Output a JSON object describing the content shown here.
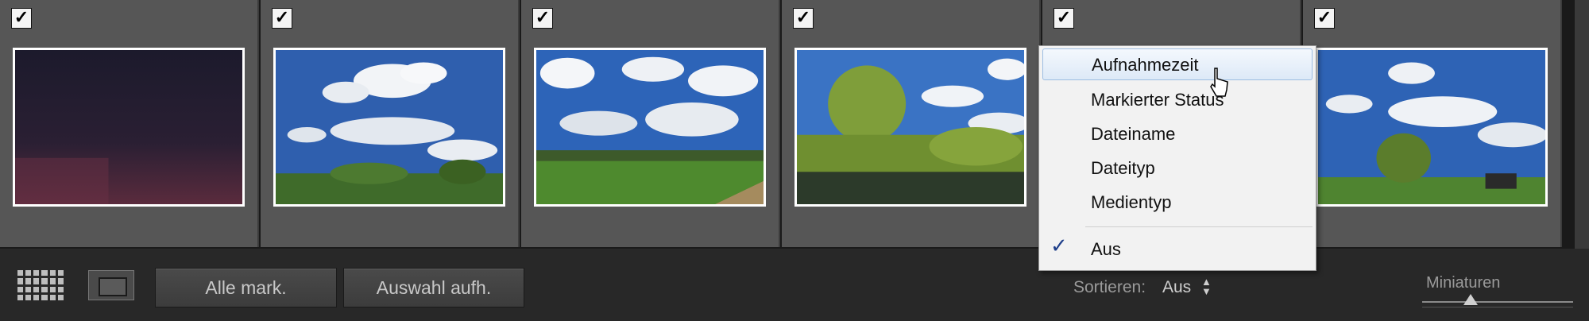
{
  "filmstrip": {
    "cells": [
      {
        "checked": true,
        "checkmark": "✓",
        "photo": "night-sky"
      },
      {
        "checked": true,
        "checkmark": "✓",
        "photo": "clouds-field"
      },
      {
        "checked": true,
        "checkmark": "✓",
        "photo": "clouds-meadow"
      },
      {
        "checked": true,
        "checkmark": "✓",
        "photo": "tree-river"
      },
      {
        "checked": true,
        "checkmark": "✓",
        "photo": "hidden"
      },
      {
        "checked": true,
        "checkmark": "✓",
        "photo": "clouds-tree"
      }
    ]
  },
  "toolbar": {
    "grid_icon": "grid-view-icon",
    "loupe_icon": "loupe-view-icon",
    "select_all_label": "Alle mark.",
    "deselect_label": "Auswahl aufh.",
    "sort_label": "Sortieren:",
    "sort_value": "Aus",
    "sort_arrows": "▲▼",
    "thumbnails_label": "Miniaturen",
    "thumbnail_size_level": 0.32
  },
  "sort_menu": {
    "items": [
      {
        "label": "Aufnahmezeit",
        "hovered": true
      },
      {
        "label": "Markierter Status"
      },
      {
        "label": "Dateiname"
      },
      {
        "label": "Dateityp"
      },
      {
        "label": "Medientyp"
      },
      {
        "label": "Aus",
        "checked": true
      }
    ],
    "check_mark": "✓"
  },
  "colors": {
    "cell_bg": "#565656",
    "toolbar_bg": "#282828",
    "menu_bg": "#f2f2f2",
    "menu_hover": "#dde9f7",
    "check_color": "#1f3f8a"
  }
}
